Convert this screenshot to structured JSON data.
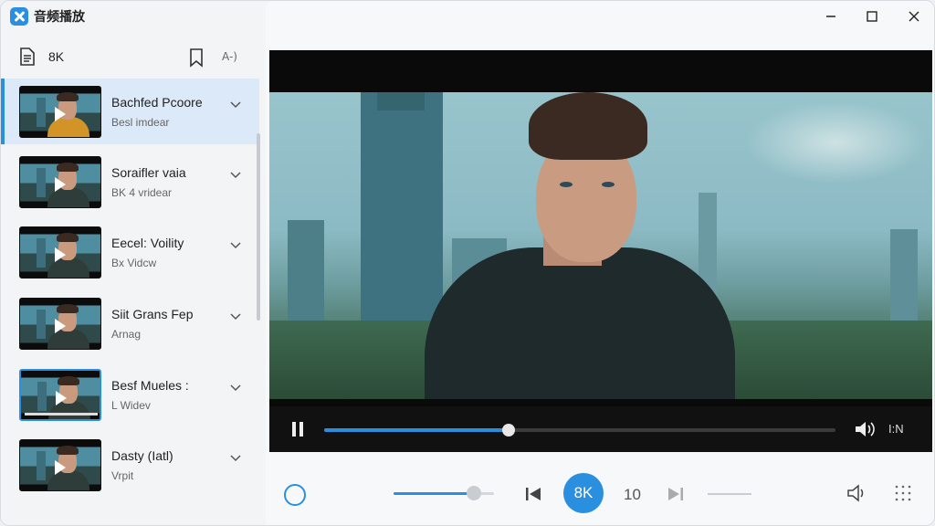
{
  "app": {
    "name": "音频播放"
  },
  "sidebar": {
    "label": "8K",
    "az_icon_text": "A-)",
    "items": [
      {
        "title": "Bachfed Pcoore",
        "subtitle": "Besl imdear",
        "selected": true
      },
      {
        "title": "Soraifler vaia",
        "subtitle": "BK 4 vridear",
        "selected": false
      },
      {
        "title": "Eecel: Voility",
        "subtitle": "Bx Vidcw",
        "selected": false
      },
      {
        "title": "Siit Grans Fep",
        "subtitle": "Arnag",
        "selected": false
      },
      {
        "title": "Besf Mueles :",
        "subtitle": "L Widev",
        "selected": false
      },
      {
        "title": "Dasty (Iatl)",
        "subtitle": "Vrpit",
        "selected": false
      }
    ]
  },
  "player": {
    "progress": 0.36,
    "speed_label": "I:N",
    "center_label": "8K",
    "number_label": "10",
    "volume_level": 0.8
  },
  "colors": {
    "accent": "#2b8fe0"
  }
}
